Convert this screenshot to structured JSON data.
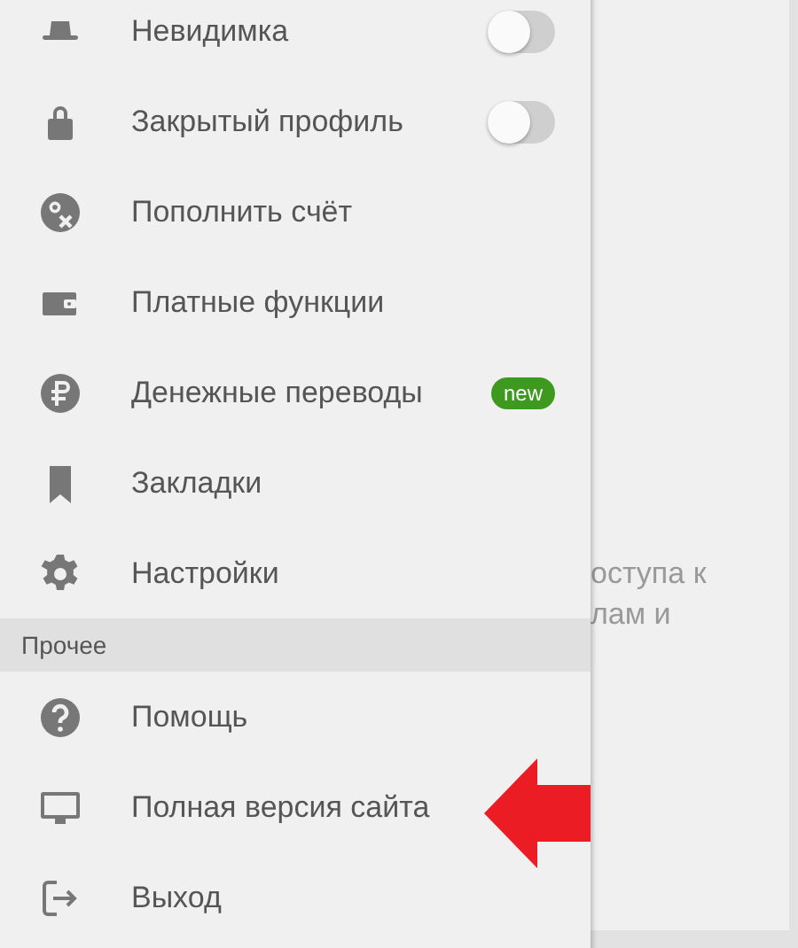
{
  "menu": {
    "items": [
      {
        "kind": "toggle",
        "label": "Невидимка",
        "on": false
      },
      {
        "kind": "toggle",
        "label": "Закрытый профиль",
        "on": false
      },
      {
        "kind": "plain",
        "label": "Пополнить счёт"
      },
      {
        "kind": "plain",
        "label": "Платные функции"
      },
      {
        "kind": "badge",
        "label": "Денежные переводы",
        "badge": "new"
      },
      {
        "kind": "plain",
        "label": "Закладки"
      },
      {
        "kind": "plain",
        "label": "Настройки"
      }
    ],
    "section": {
      "title": "Прочее",
      "items": [
        {
          "label": "Помощь"
        },
        {
          "label": "Полная версия сайта"
        },
        {
          "label": "Выход"
        }
      ]
    }
  },
  "background_page": {
    "text_lines": [
      "оступа к",
      "лам и"
    ]
  }
}
